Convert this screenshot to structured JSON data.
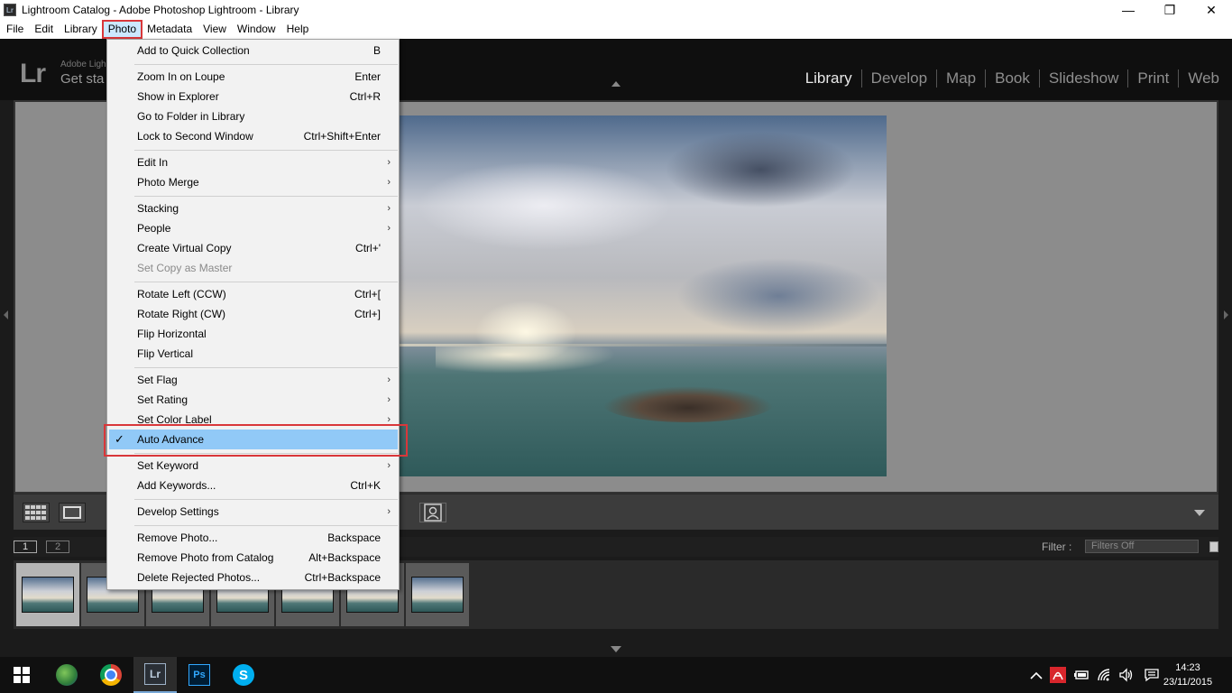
{
  "window": {
    "title": "Lightroom Catalog - Adobe Photoshop Lightroom - Library",
    "app_icon": "Lr",
    "controls": {
      "minimize": "—",
      "restore": "❐",
      "close": "✕"
    }
  },
  "menubar": {
    "items": [
      "File",
      "Edit",
      "Library",
      "Photo",
      "Metadata",
      "View",
      "Window",
      "Help"
    ],
    "active": "Photo"
  },
  "lr_header": {
    "logo": "Lr",
    "small_text": "Adobe Ligh",
    "get_started": "Get sta",
    "modules": [
      "Library",
      "Develop",
      "Map",
      "Book",
      "Slideshow",
      "Print",
      "Web"
    ],
    "current_module": "Library"
  },
  "photo_menu": {
    "items": [
      {
        "label": "Add to Quick Collection",
        "shortcut": "B"
      },
      {
        "label": "Zoom In on Loupe",
        "shortcut": "Enter"
      },
      {
        "label": "Show in Explorer",
        "shortcut": "Ctrl+R"
      },
      {
        "label": "Go to Folder in Library",
        "shortcut": ""
      },
      {
        "label": "Lock to Second Window",
        "shortcut": "Ctrl+Shift+Enter"
      },
      {
        "label": "Edit In",
        "shortcut": "",
        "submenu": true
      },
      {
        "label": "Photo Merge",
        "shortcut": "",
        "submenu": true
      },
      {
        "label": "Stacking",
        "shortcut": "",
        "submenu": true
      },
      {
        "label": "People",
        "shortcut": "",
        "submenu": true
      },
      {
        "label": "Create Virtual Copy",
        "shortcut": "Ctrl+'"
      },
      {
        "label": "Set Copy as Master",
        "shortcut": "",
        "disabled": true
      },
      {
        "label": "Rotate Left (CCW)",
        "shortcut": "Ctrl+["
      },
      {
        "label": "Rotate Right (CW)",
        "shortcut": "Ctrl+]"
      },
      {
        "label": "Flip Horizontal",
        "shortcut": ""
      },
      {
        "label": "Flip Vertical",
        "shortcut": ""
      },
      {
        "label": "Set Flag",
        "shortcut": "",
        "submenu": true
      },
      {
        "label": "Set Rating",
        "shortcut": "",
        "submenu": true
      },
      {
        "label": "Set Color Label",
        "shortcut": "",
        "submenu": true
      },
      {
        "label": "Auto Advance",
        "shortcut": "",
        "checked": true,
        "highlighted": true
      },
      {
        "label": "Set Keyword",
        "shortcut": "",
        "submenu": true
      },
      {
        "label": "Add Keywords...",
        "shortcut": "Ctrl+K"
      },
      {
        "label": "Develop Settings",
        "shortcut": "",
        "submenu": true
      },
      {
        "label": "Remove Photo...",
        "shortcut": "Backspace"
      },
      {
        "label": "Remove Photo from Catalog",
        "shortcut": "Alt+Backspace"
      },
      {
        "label": "Delete Rejected Photos...",
        "shortcut": "Ctrl+Backspace"
      }
    ],
    "check_mark": "✓",
    "submenu_arrow": "›"
  },
  "filmstrip": {
    "monitor_buttons": [
      "1",
      "2"
    ],
    "filter_label": "Filter :",
    "filter_value": "Filters Off",
    "thumb_count": 7,
    "selected_index": 0
  },
  "taskbar": {
    "clock_time": "14:23",
    "clock_date": "23/11/2015",
    "apps": [
      "start-icon",
      "globe-icon",
      "chrome-icon",
      "lightroom-icon",
      "photoshop-icon",
      "skype-icon"
    ],
    "lr_label": "Lr",
    "ps_label": "Ps",
    "skype_label": "S"
  },
  "colors": {
    "highlight_border": "#d9373a",
    "menu_highlight": "#91c9f7",
    "menubar_active": "#cce8ff"
  }
}
